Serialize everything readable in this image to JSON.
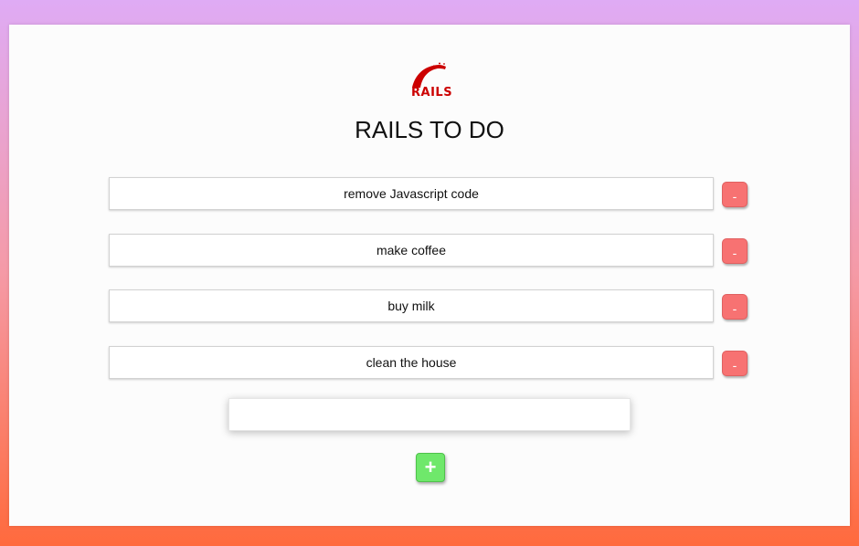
{
  "app": {
    "logo_icon": "rails-logo-icon",
    "logo_text": "RAILS",
    "title": "RAILS TO DO",
    "brand_color": "#cc0000"
  },
  "todos": [
    {
      "text": "remove Javascript code",
      "remove_label": "-"
    },
    {
      "text": "make coffee",
      "remove_label": "-"
    },
    {
      "text": "buy milk",
      "remove_label": "-"
    },
    {
      "text": "clean the house",
      "remove_label": "-"
    }
  ],
  "new_todo": {
    "value": "",
    "placeholder": ""
  },
  "add_button": {
    "label": "+",
    "color": "#6fe86b"
  },
  "remove_button": {
    "color": "#f77272"
  }
}
